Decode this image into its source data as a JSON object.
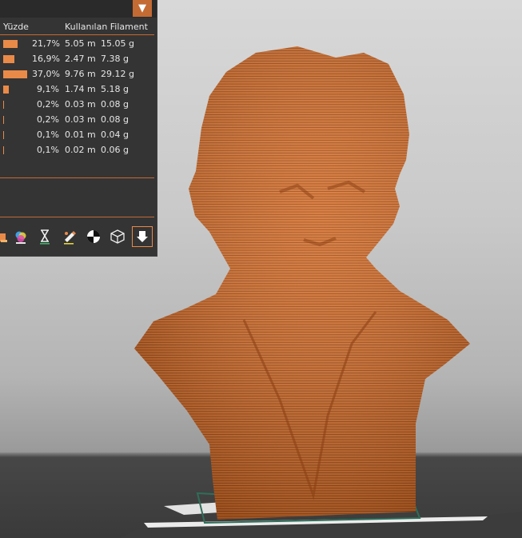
{
  "stats_panel": {
    "dropdown_icon": "triangle-down-icon",
    "header_percent": "Yüzde",
    "header_used_filament": "Kullanılan Filament",
    "bar_color": "#e98a48",
    "accent_color": "#c46a33",
    "rows": [
      {
        "percent_value": 21.7,
        "percent": "21,7%",
        "length": "5.05 m",
        "weight": "15.05 g"
      },
      {
        "percent_value": 16.9,
        "percent": "16,9%",
        "length": "2.47 m",
        "weight": "7.38 g"
      },
      {
        "percent_value": 37.0,
        "percent": "37,0%",
        "length": "9.76 m",
        "weight": "29.12 g"
      },
      {
        "percent_value": 9.1,
        "percent": "9,1%",
        "length": "1.74 m",
        "weight": "5.18 g"
      },
      {
        "percent_value": 0.2,
        "percent": "0,2%",
        "length": "0.03 m",
        "weight": "0.08 g"
      },
      {
        "percent_value": 0.2,
        "percent": "0,2%",
        "length": "0.03 m",
        "weight": "0.08 g"
      },
      {
        "percent_value": 0.1,
        "percent": "0,1%",
        "length": "0.01 m",
        "weight": "0.04 g"
      },
      {
        "percent_value": 0.1,
        "percent": "0,1%",
        "length": "0.02 m",
        "weight": "0.06 g"
      }
    ]
  },
  "toolbar": {
    "icons": [
      "feature-type-icon",
      "color-print-icon",
      "print-time-icon",
      "tool-marker-icon",
      "center-of-mass-icon",
      "wireframe-cube-icon",
      "export-gcode-icon"
    ]
  },
  "viewport": {
    "model_color": "#d9722e",
    "bed_border_color": "#2f6e5a"
  }
}
